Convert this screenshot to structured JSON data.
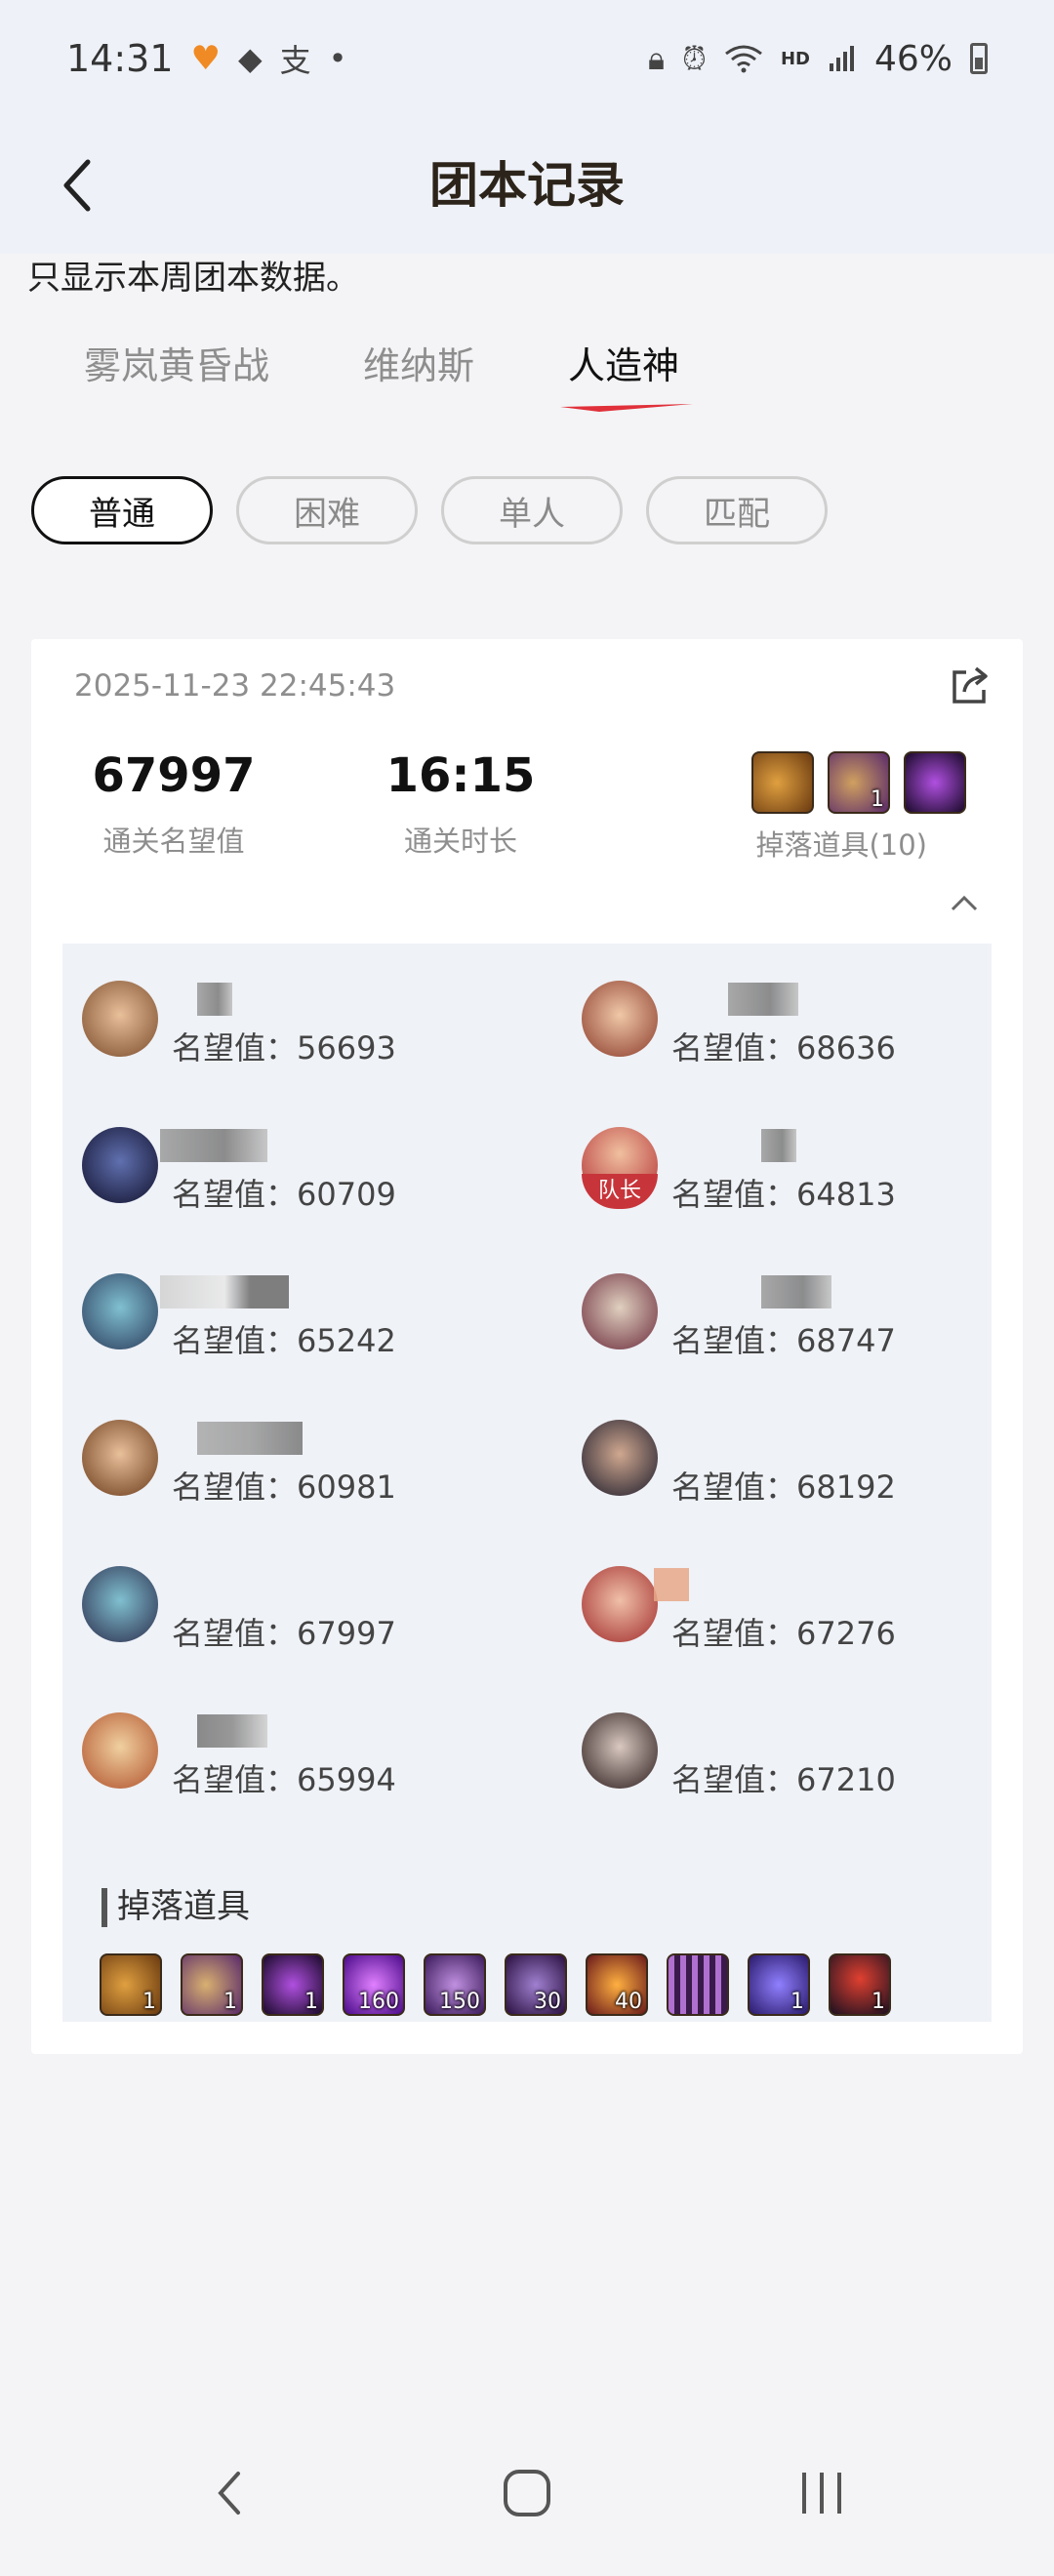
{
  "status_bar": {
    "time": "14:31",
    "hd": "HD",
    "battery": "46%"
  },
  "header": {
    "title": "团本记录"
  },
  "notice": "只显示本周团本数据。",
  "tabs": [
    {
      "label": "雾岚黄昏战",
      "active": false
    },
    {
      "label": "维纳斯",
      "active": false
    },
    {
      "label": "人造神",
      "active": true
    }
  ],
  "difficulty_chips": [
    {
      "label": "普通",
      "active": true
    },
    {
      "label": "困难",
      "active": false
    },
    {
      "label": "单人",
      "active": false
    },
    {
      "label": "匹配",
      "active": false
    }
  ],
  "record": {
    "datetime": "2025-11-23 22:45:43",
    "fame_value": "67997",
    "fame_label": "通关名望值",
    "duration_value": "16:15",
    "duration_label": "通关时长",
    "drops_label": "掉落道具(10)",
    "members": [
      {
        "fame": "名望值：56693",
        "leader": false
      },
      {
        "fame": "名望值：68636",
        "leader": false
      },
      {
        "fame": "名望值：60709",
        "leader": false
      },
      {
        "fame": "名望值：64813",
        "leader": true,
        "badge": "队长"
      },
      {
        "fame": "名望值：65242",
        "leader": false
      },
      {
        "fame": "名望值：68747",
        "leader": false
      },
      {
        "fame": "名望值：60981",
        "leader": false
      },
      {
        "fame": "名望值：68192",
        "leader": false
      },
      {
        "fame": "名望值：67997",
        "leader": false
      },
      {
        "fame": "名望值：67276",
        "leader": false
      },
      {
        "fame": "名望值：65994",
        "leader": false
      },
      {
        "fame": "名望值：67210",
        "leader": false
      }
    ],
    "drops_section_title": "掉落道具",
    "drop_items": [
      {
        "qty": "1",
        "color": "#b5782f"
      },
      {
        "qty": "1",
        "color": "#8a5a9a"
      },
      {
        "qty": "1",
        "color": "#3a1f4a"
      },
      {
        "qty": "160",
        "color": "#7a2bb8"
      },
      {
        "qty": "150",
        "color": "#5a2a7a"
      },
      {
        "qty": "30",
        "color": "#4a2a6a"
      },
      {
        "qty": "40",
        "color": "#a0401a"
      },
      {
        "qty": "",
        "color": "#6a3a8a"
      },
      {
        "qty": "1",
        "color": "#5a3ab0"
      },
      {
        "qty": "1",
        "color": "#2a1a3a"
      }
    ]
  },
  "colors": {
    "accent_underline": "#e0303a",
    "panel_bg": "#eff2f7"
  }
}
